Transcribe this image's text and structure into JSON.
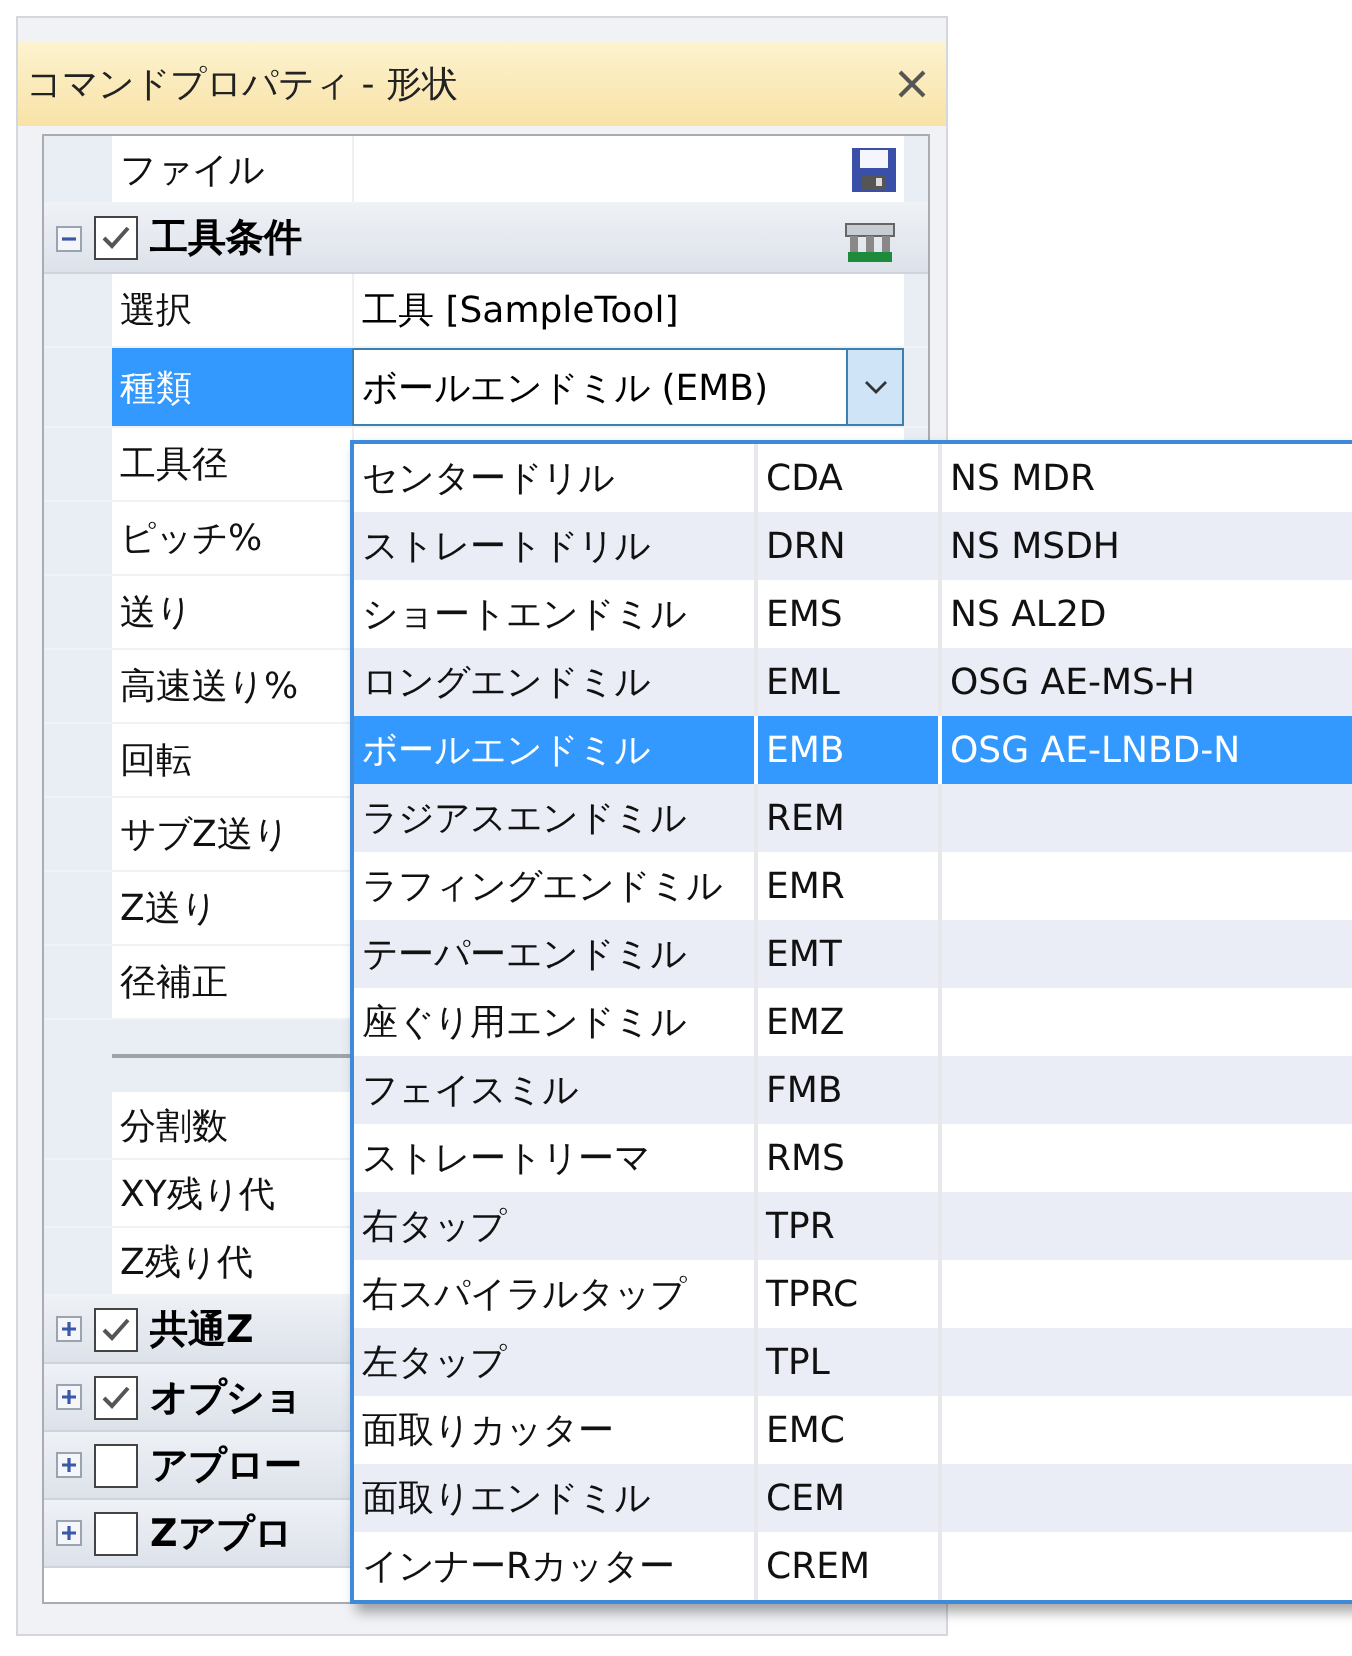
{
  "window": {
    "title": "コマンドプロパティ - 形状"
  },
  "rows": [
    {
      "kind": "file",
      "label": "ファイル"
    },
    {
      "kind": "category",
      "label": "工具条件",
      "checked": true,
      "expanded": true,
      "tool_button": true
    },
    {
      "kind": "property",
      "label": "選択",
      "value": "工具 [SampleTool]",
      "selected": false
    },
    {
      "kind": "combo",
      "label": "種類",
      "value": "ボールエンドミル (EMB)",
      "selected": true
    },
    {
      "kind": "property",
      "label": "工具径",
      "selected": false
    },
    {
      "kind": "property",
      "label": "ピッチ%",
      "selected": false
    },
    {
      "kind": "property",
      "label": "送り",
      "selected": false
    },
    {
      "kind": "property",
      "label": "高速送り%",
      "selected": false
    },
    {
      "kind": "property",
      "label": "回転",
      "selected": false
    },
    {
      "kind": "property",
      "label": "サブZ送り",
      "selected": false
    },
    {
      "kind": "property",
      "label": "Z送り",
      "selected": false
    },
    {
      "kind": "property",
      "label": "径補正",
      "selected": false
    },
    {
      "kind": "separator"
    },
    {
      "kind": "property",
      "label": "分割数",
      "selected": false
    },
    {
      "kind": "property",
      "label": "XY残り代",
      "selected": false
    },
    {
      "kind": "property",
      "label": "Z残り代",
      "selected": false
    },
    {
      "kind": "category",
      "label": "共通Z",
      "checked": true,
      "expanded": false
    },
    {
      "kind": "category",
      "label": "オプショ",
      "checked": true,
      "expanded": false
    },
    {
      "kind": "category",
      "label": "アプロー",
      "checked": false,
      "expanded": false
    },
    {
      "kind": "category",
      "label": "Zアプロ",
      "checked": false,
      "expanded": false
    }
  ],
  "dropdown": [
    {
      "name": "センタードリル",
      "code": "CDA",
      "maker": "NS MDR",
      "selected": false
    },
    {
      "name": "ストレートドリル",
      "code": "DRN",
      "maker": "NS MSDH",
      "selected": false
    },
    {
      "name": "ショートエンドミル",
      "code": "EMS",
      "maker": "NS AL2D",
      "selected": false
    },
    {
      "name": "ロングエンドミル",
      "code": "EML",
      "maker": "OSG AE-MS-H",
      "selected": false
    },
    {
      "name": "ボールエンドミル",
      "code": "EMB",
      "maker": "OSG AE-LNBD-N",
      "selected": true
    },
    {
      "name": "ラジアスエンドミル",
      "code": "REM",
      "selected": false
    },
    {
      "name": "ラフィングエンドミル",
      "code": "EMR",
      "selected": false
    },
    {
      "name": "テーパーエンドミル",
      "code": "EMT",
      "selected": false
    },
    {
      "name": "座ぐり用エンドミル",
      "code": "EMZ",
      "selected": false
    },
    {
      "name": "フェイスミル",
      "code": "FMB",
      "selected": false
    },
    {
      "name": "ストレートリーマ",
      "code": "RMS",
      "selected": false
    },
    {
      "name": "右タップ",
      "code": "TPR",
      "selected": false
    },
    {
      "name": "右スパイラルタップ",
      "code": "TPRC",
      "selected": false
    },
    {
      "name": "左タップ",
      "code": "TPL",
      "selected": false
    },
    {
      "name": "面取りカッター",
      "code": "EMC",
      "selected": false
    },
    {
      "name": "面取りエンドミル",
      "code": "CEM",
      "selected": false
    },
    {
      "name": "インナーRカッター",
      "code": "CREM",
      "selected": false
    }
  ]
}
